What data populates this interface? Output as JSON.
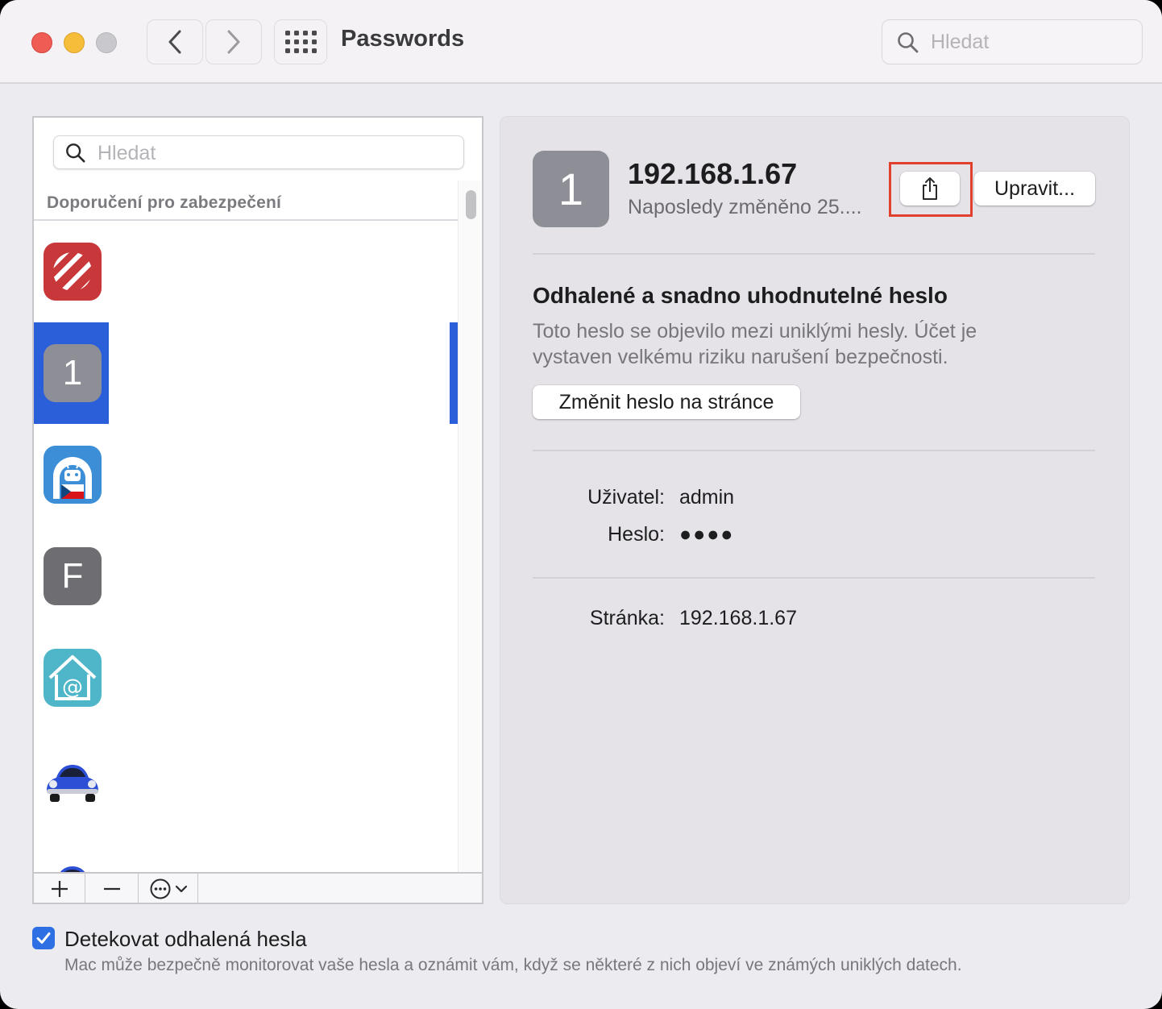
{
  "window": {
    "title": "Passwords",
    "search_placeholder": "Hledat"
  },
  "list": {
    "search_placeholder": "Hledat",
    "section_header": "Doporučení pro zabezpečení",
    "items": [
      {
        "icon": "striped-red-app-icon",
        "letter": ""
      },
      {
        "icon": "letter-1-icon",
        "letter": "1",
        "selected": true
      },
      {
        "icon": "android-czech-app-icon",
        "letter": ""
      },
      {
        "icon": "letter-f-icon",
        "letter": "F"
      },
      {
        "icon": "home-at-mail-app-icon",
        "letter": ""
      },
      {
        "icon": "blue-beetle-car-icon",
        "letter": ""
      }
    ],
    "buttons": {
      "add": "+",
      "remove": "−"
    }
  },
  "detail": {
    "icon_letter": "1",
    "title": "192.168.1.67",
    "subtitle": "Naposledy změněno 25....",
    "edit_label": "Upravit...",
    "warning_title": "Odhalené a snadno uhodnutelné heslo",
    "warning_text": "Toto heslo se objevilo mezi uniklými hesly. Účet je vystaven velkému riziku narušení bezpečnosti.",
    "change_label": "Změnit heslo na stránce",
    "user_label": "Uživatel:",
    "user_value": "admin",
    "password_label": "Heslo:",
    "password_value": "●●●●",
    "site_label": "Stránka:",
    "site_value": "192.168.1.67"
  },
  "footer": {
    "checkbox_label": "Detekovat odhalená hesla",
    "checkbox_checked": true,
    "description": "Mac může bezpečně monitorovat vaše hesla a oznámit vám, když se některé z nich objeví ve známých uniklých datech."
  },
  "colors": {
    "accent": "#2b5fd9",
    "highlight": "#e0402d",
    "close": "#ee5c54",
    "minimize": "#f5bd3a"
  }
}
